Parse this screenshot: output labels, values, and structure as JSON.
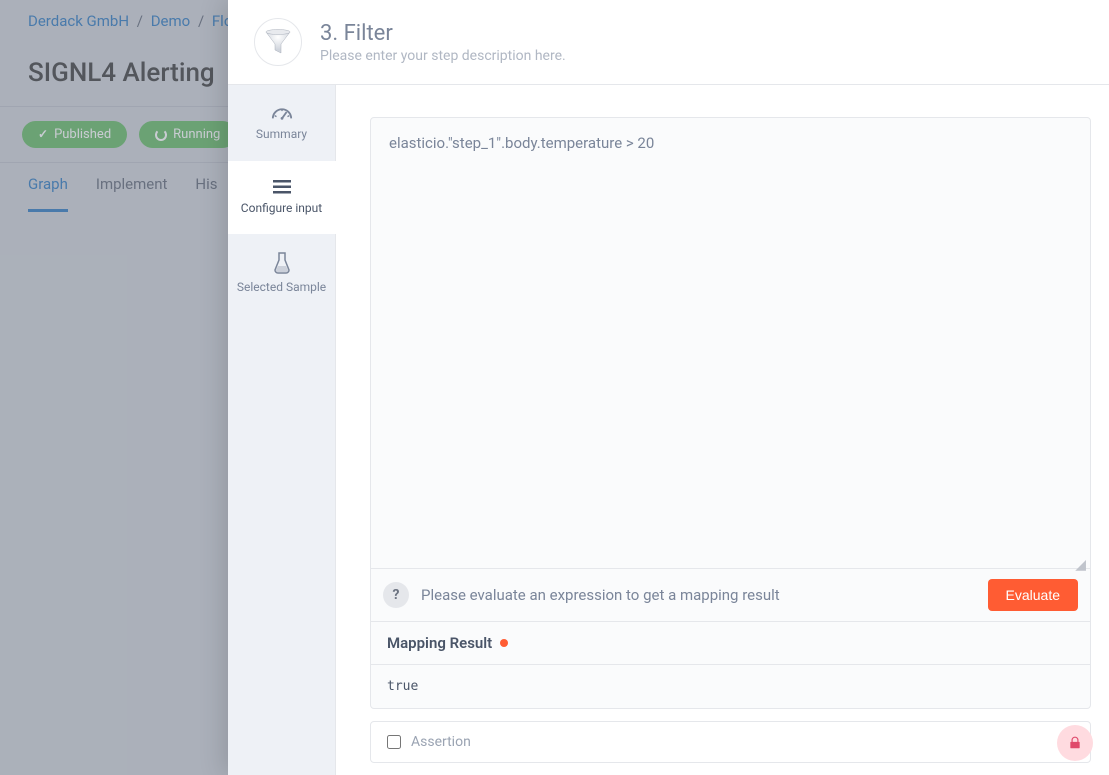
{
  "breadcrumb": {
    "org": "Derdack GmbH",
    "workspace": "Demo",
    "item": "Flo",
    "sep": "/"
  },
  "flowTitle": "SIGNL4 Alerting",
  "status": {
    "published": "Published",
    "running": "Running"
  },
  "tabs": {
    "graph": "Graph",
    "implement": "Implement",
    "history": "His"
  },
  "step": {
    "title": "3. Filter",
    "descPlaceholder": "Please enter your step description here."
  },
  "vtabs": {
    "summary": "Summary",
    "configure": "Configure input",
    "sample": "Selected Sample"
  },
  "editor": {
    "value": "elasticio.\"step_1\".body.temperature > 20"
  },
  "eval": {
    "hint": "Please evaluate an expression to get a mapping result",
    "button": "Evaluate"
  },
  "result": {
    "label": "Mapping Result",
    "value": "true"
  },
  "assertion": {
    "label": "Assertion"
  }
}
